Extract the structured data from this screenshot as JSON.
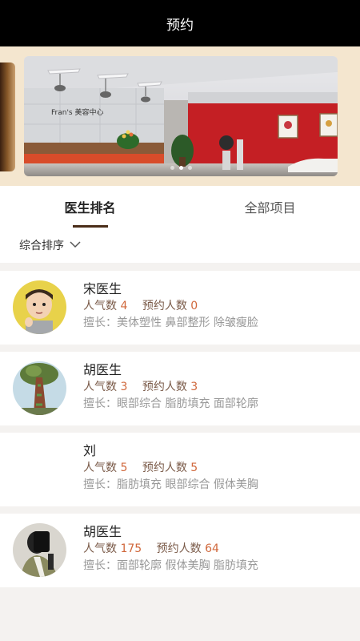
{
  "header": {
    "title": "预约"
  },
  "tabs": [
    {
      "label": "医生排名",
      "active": true
    },
    {
      "label": "全部项目",
      "active": false
    }
  ],
  "filter": {
    "label": "综合排序"
  },
  "banner": {
    "sign_text": "Fran's 美容中心"
  },
  "doctors": [
    {
      "name": "宋医生",
      "popularity_label": "人气数",
      "popularity": "4",
      "appointments_label": "预约人数",
      "appointments": "0",
      "skills": "擅长：美体塑性 鼻部整形 除皱瘦脸",
      "has_avatar": true
    },
    {
      "name": "胡医生",
      "popularity_label": "人气数",
      "popularity": "3",
      "appointments_label": "预约人数",
      "appointments": "3",
      "skills": "擅长：眼部综合 脂肪填充 面部轮廓",
      "has_avatar": true
    },
    {
      "name": "刘",
      "popularity_label": "人气数",
      "popularity": "5",
      "appointments_label": "预约人数",
      "appointments": "5",
      "skills": "擅长：脂肪填充 眼部综合 假体美胸",
      "has_avatar": false
    },
    {
      "name": "胡医生",
      "popularity_label": "人气数",
      "popularity": "175",
      "appointments_label": "预约人数",
      "appointments": "64",
      "skills": "擅长：面部轮廓 假体美胸 脂肪填充",
      "has_avatar": true
    }
  ],
  "colors": {
    "header_bg": "#000000",
    "banner_bg": "#f4e6cf",
    "tab_underline": "#4a2d18",
    "number_accent": "#d0683c",
    "stat_label": "#7a5a48",
    "skills_text": "#999999"
  },
  "icons": {
    "filter_chevron": "chevron-down-icon"
  }
}
